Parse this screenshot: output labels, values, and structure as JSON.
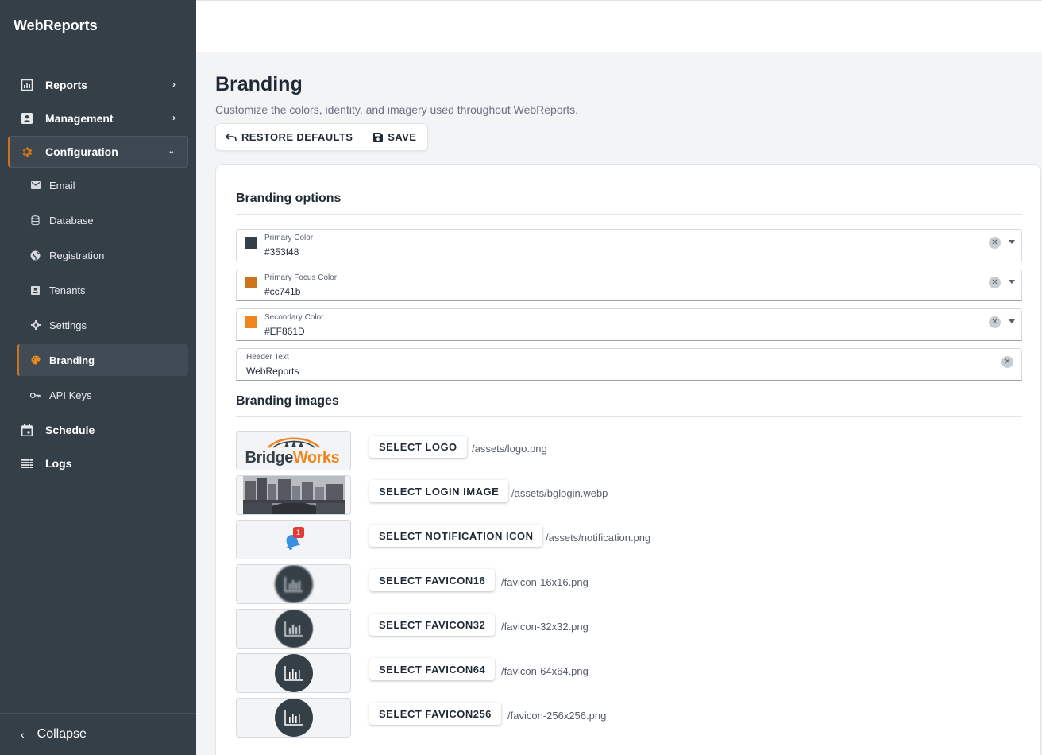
{
  "app": {
    "title": "WebReports"
  },
  "sidebar": {
    "items": [
      {
        "label": "Reports",
        "icon": "bar-chart-icon"
      },
      {
        "label": "Management",
        "icon": "id-card-icon"
      },
      {
        "label": "Configuration",
        "icon": "gear-icon"
      }
    ],
    "sub_items": [
      {
        "label": "Email",
        "icon": "envelope-icon"
      },
      {
        "label": "Database",
        "icon": "database-icon"
      },
      {
        "label": "Registration",
        "icon": "globe-icon"
      },
      {
        "label": "Tenants",
        "icon": "id-badge-icon"
      },
      {
        "label": "Settings",
        "icon": "gear-icon"
      },
      {
        "label": "Branding",
        "icon": "palette-icon"
      },
      {
        "label": "API Keys",
        "icon": "key-icon"
      }
    ],
    "bottom_items": [
      {
        "label": "Schedule",
        "icon": "calendar-icon"
      },
      {
        "label": "Logs",
        "icon": "list-icon"
      }
    ],
    "collapse_label": "Collapse"
  },
  "page": {
    "title": "Branding",
    "subtitle": "Customize the colors, identity, and imagery used throughout WebReports.",
    "restore_label": "RESTORE DEFAULTS",
    "save_label": "SAVE"
  },
  "options": {
    "title": "Branding options",
    "fields": [
      {
        "label": "Primary Color",
        "value": "#353f48",
        "swatch": "#353f48"
      },
      {
        "label": "Primary Focus Color",
        "value": "#cc741b",
        "swatch": "#cc741b"
      },
      {
        "label": "Secondary Color",
        "value": "#EF861D",
        "swatch": "#EF861D"
      },
      {
        "label": "Header Text",
        "value": "WebReports"
      }
    ]
  },
  "images": {
    "title": "Branding images",
    "logo_text": {
      "part1": "Bridge",
      "part2": "Works"
    },
    "notification_badge": "1",
    "rows": [
      {
        "button": "SELECT LOGO",
        "path": "/assets/logo.png"
      },
      {
        "button": "SELECT LOGIN IMAGE",
        "path": "/assets/bglogin.webp"
      },
      {
        "button": "SELECT NOTIFICATION ICON",
        "path": "/assets/notification.png"
      },
      {
        "button": "SELECT FAVICON16",
        "path": "/favicon-16x16.png"
      },
      {
        "button": "SELECT FAVICON32",
        "path": "/favicon-32x32.png"
      },
      {
        "button": "SELECT FAVICON64",
        "path": "/favicon-64x64.png"
      },
      {
        "button": "SELECT FAVICON256",
        "path": "/favicon-256x256.png"
      }
    ]
  },
  "colors": {
    "sidebar": "#353f48",
    "accent": "#cc741b",
    "secondary": "#EF861D"
  }
}
